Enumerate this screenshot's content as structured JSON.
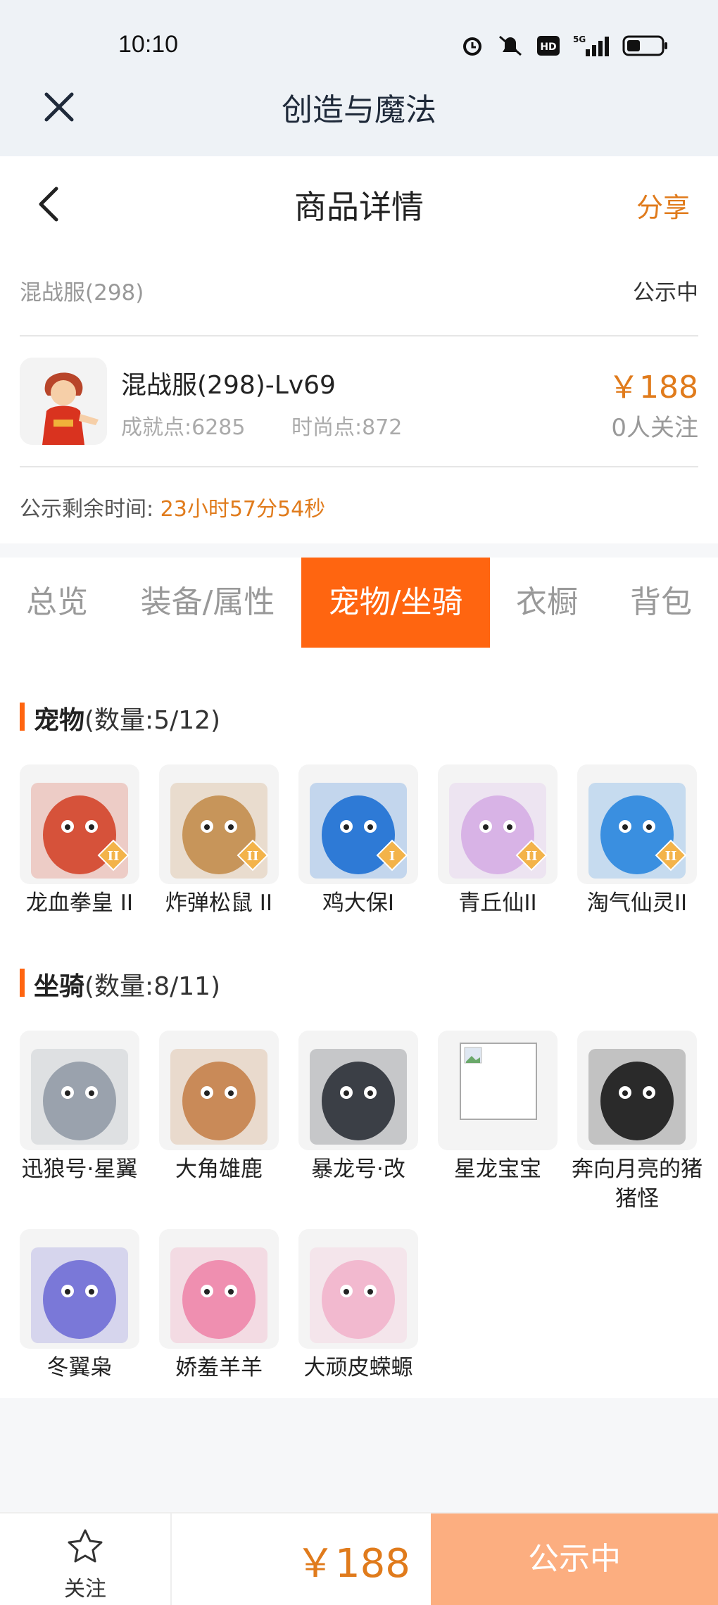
{
  "status_bar": {
    "time": "10:10",
    "icons": [
      "alarm-icon",
      "mute-icon",
      "hd-icon",
      "signal-5g-icon",
      "battery-icon"
    ]
  },
  "app_bar": {
    "title": "创造与魔法"
  },
  "nav": {
    "title": "商品详情",
    "share_label": "分享"
  },
  "info": {
    "server": "混战服(298)",
    "status": "公示中",
    "character_name": "混战服(298)-Lv69",
    "achievement": "成就点:6285",
    "fashion": "时尚点:872",
    "price": "￥188",
    "followers": "0人关注",
    "remaining_label": "公示剩余时间:",
    "remaining_value": "23小时57分54秒"
  },
  "tabs": [
    {
      "label": "总览"
    },
    {
      "label": "装备/属性"
    },
    {
      "label": "宠物/坐骑",
      "active": true
    },
    {
      "label": "衣橱"
    },
    {
      "label": "背包"
    }
  ],
  "pets": {
    "title": "宠物",
    "count": "(数量:5/12)",
    "items": [
      {
        "name": "龙血拳皇 II",
        "badge": "II",
        "color": "#d6523a"
      },
      {
        "name": "炸弹松鼠 II",
        "badge": "II",
        "color": "#c7955a"
      },
      {
        "name": "鸡大保I",
        "badge": "I",
        "color": "#2e7ad6"
      },
      {
        "name": "青丘仙II",
        "badge": "II",
        "color": "#d8b3e6"
      },
      {
        "name": "淘气仙灵II",
        "badge": "II",
        "color": "#3a8fe0"
      }
    ]
  },
  "mounts": {
    "title": "坐骑",
    "count": "(数量:8/11)",
    "items": [
      {
        "name": "迅狼号·星翼",
        "color": "#9aa2ad"
      },
      {
        "name": "大角雄鹿",
        "color": "#c98a58"
      },
      {
        "name": "暴龙号·改",
        "color": "#3b3f46"
      },
      {
        "name": "星龙宝宝",
        "color": "#ffffff"
      },
      {
        "name": "奔向月亮的猪猪怪",
        "color": "#2a2a2a"
      },
      {
        "name": "冬翼枭",
        "color": "#7a78d8"
      },
      {
        "name": "娇羞羊羊",
        "color": "#ef8fb0"
      },
      {
        "name": "大顽皮蝾螈",
        "color": "#f2b9cf"
      }
    ]
  },
  "bottom_bar": {
    "follow_label": "关注",
    "price": "￥188",
    "status_label": "公示中"
  }
}
